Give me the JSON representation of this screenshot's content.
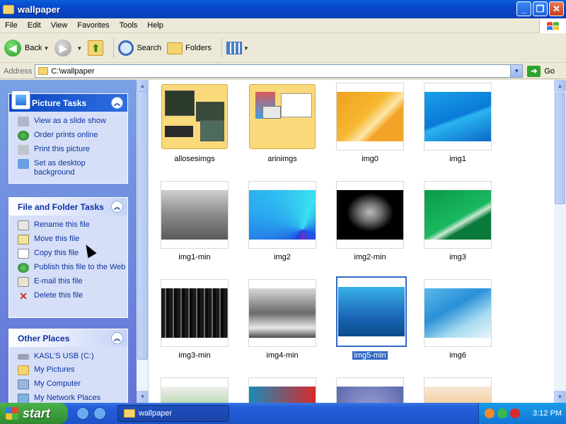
{
  "window": {
    "title": "wallpaper"
  },
  "menu": [
    "File",
    "Edit",
    "View",
    "Favorites",
    "Tools",
    "Help"
  ],
  "toolbar": {
    "back": "Back",
    "search": "Search",
    "folders": "Folders"
  },
  "address": {
    "label": "Address",
    "path": "C:\\wallpaper",
    "go": "Go"
  },
  "taskpane": {
    "picture_tasks": {
      "title": "Picture Tasks",
      "items": [
        "View as a slide show",
        "Order prints online",
        "Print this picture",
        "Set as desktop background"
      ]
    },
    "file_tasks": {
      "title": "File and Folder Tasks",
      "items": [
        "Rename this file",
        "Move this file",
        "Copy this file",
        "Publish this file to the Web",
        "E-mail this file",
        "Delete this file"
      ]
    },
    "other_places": {
      "title": "Other Places",
      "items": [
        "KASL'S USB (C:)",
        "My Pictures",
        "My Computer",
        "My Network Places"
      ]
    }
  },
  "files": [
    {
      "name": "allosesimgs",
      "kind": "folder"
    },
    {
      "name": "arinimgs",
      "kind": "folder"
    },
    {
      "name": "img0",
      "kind": "image"
    },
    {
      "name": "img1",
      "kind": "image"
    },
    {
      "name": "img1-min",
      "kind": "image"
    },
    {
      "name": "img2",
      "kind": "image"
    },
    {
      "name": "img2-min",
      "kind": "image"
    },
    {
      "name": "img3",
      "kind": "image"
    },
    {
      "name": "img3-min",
      "kind": "image"
    },
    {
      "name": "img4-min",
      "kind": "image"
    },
    {
      "name": "img5-min",
      "kind": "image",
      "selected": true
    },
    {
      "name": "img6",
      "kind": "image"
    }
  ],
  "taskbar": {
    "start": "start",
    "window": "wallpaper",
    "time": "3:12 PM"
  },
  "colors": {
    "selection": "#316ac5",
    "title_bar": "#0a5fd8",
    "task_link": "#0c32a4"
  }
}
